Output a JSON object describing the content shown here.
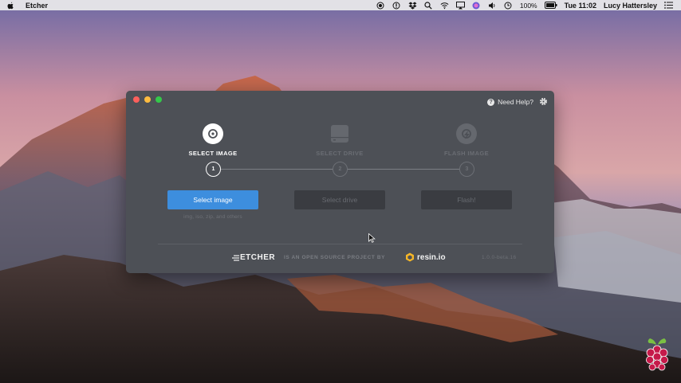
{
  "menubar": {
    "app_name": "Etcher",
    "battery": "100%",
    "clock": "Tue 11:02",
    "user": "Lucy Hattersley",
    "icons": [
      "apple-icon",
      "record-icon",
      "info-circle-icon",
      "dropbox-icon",
      "search-icon",
      "wifi-icon",
      "airplay-icon",
      "siri-icon",
      "volume-icon",
      "time-machine-icon",
      "battery-icon",
      "list-icon"
    ]
  },
  "window": {
    "help_label": "Need Help?",
    "steps": [
      {
        "title": "SELECT IMAGE",
        "number": "1",
        "button": "Select image",
        "active": true
      },
      {
        "title": "SELECT DRIVE",
        "number": "2",
        "button": "Select drive",
        "active": false
      },
      {
        "title": "FLASH IMAGE",
        "number": "3",
        "button": "Flash!",
        "active": false
      }
    ],
    "image_hint": "img, iso, zip, and others",
    "footer": {
      "brand": "ETCHER",
      "tagline": "IS AN OPEN SOURCE PROJECT BY",
      "resin": "resin.io",
      "version": "1.0.0-beta.16"
    }
  },
  "colors": {
    "accent": "#3d8ede",
    "window_bg": "#4d5056",
    "disabled_button": "#3a3c41"
  }
}
